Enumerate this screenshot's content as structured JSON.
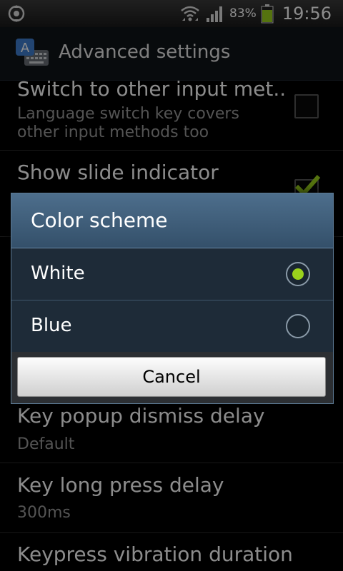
{
  "status_bar": {
    "battery_percent": "83%",
    "time": "19:56",
    "icons": [
      "sync-icon",
      "wifi-icon",
      "signal-icon",
      "battery-icon"
    ],
    "battery_level": 0.83,
    "battery_color": "#9bd21c"
  },
  "action_bar": {
    "title": "Advanced settings",
    "icon": "keyboard-app-icon"
  },
  "settings": {
    "items": [
      {
        "title": "Switch to other input met..",
        "summary_line1": "Language switch key covers",
        "summary_line2": "other input methods too",
        "checked": false
      },
      {
        "title": "Show slide indicator",
        "checked": true
      },
      {
        "title": "Key popup dismiss delay",
        "summary": "Default"
      },
      {
        "title": "Key long press delay",
        "summary": "300ms"
      },
      {
        "title": "Keypress vibration duration"
      }
    ]
  },
  "dialog": {
    "title": "Color scheme",
    "options": [
      {
        "label": "White",
        "selected": true
      },
      {
        "label": "Blue",
        "selected": false
      }
    ],
    "cancel_label": "Cancel",
    "accent_color": "#9bd21c"
  }
}
